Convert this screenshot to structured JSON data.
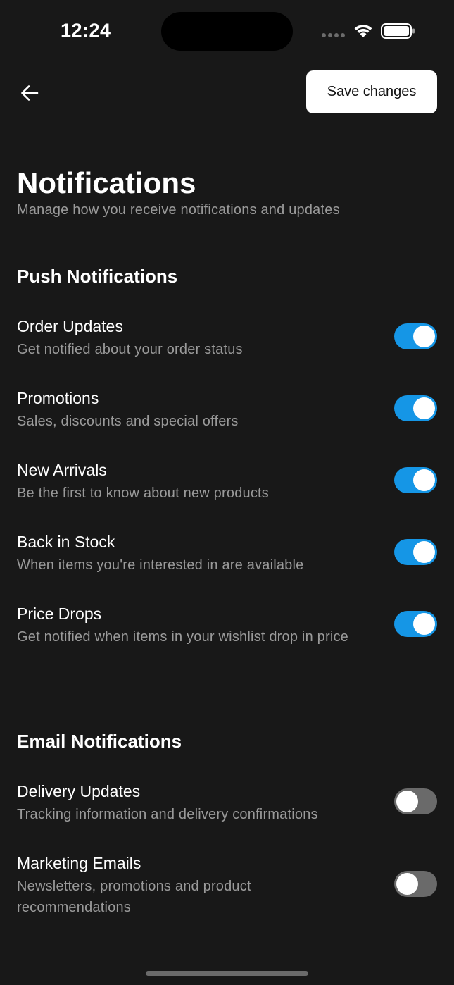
{
  "status_bar": {
    "time": "12:24"
  },
  "header": {
    "save_label": "Save changes"
  },
  "page": {
    "title": "Notifications",
    "subtitle": "Manage how you receive notifications and updates"
  },
  "push": {
    "title": "Push Notifications",
    "items": [
      {
        "label": "Order Updates",
        "description": "Get notified about your order status",
        "enabled": true
      },
      {
        "label": "Promotions",
        "description": "Sales, discounts and special offers",
        "enabled": true
      },
      {
        "label": "New Arrivals",
        "description": "Be the first to know about new products",
        "enabled": true
      },
      {
        "label": "Back in Stock",
        "description": "When items you're interested in are available",
        "enabled": true
      },
      {
        "label": "Price Drops",
        "description": "Get notified when items in your wishlist drop in price",
        "enabled": true
      }
    ]
  },
  "email": {
    "title": "Email Notifications",
    "items": [
      {
        "label": "Delivery Updates",
        "description": "Tracking information and delivery confirmations",
        "enabled": false
      },
      {
        "label": "Marketing Emails",
        "description": "Newsletters, promotions and product recommendations",
        "enabled": false
      }
    ]
  },
  "colors": {
    "background": "#181818",
    "toggle_on": "#1596e6",
    "toggle_off": "#6a6a6a",
    "secondary_text": "#9a9a9a"
  },
  "icons": {
    "back": "arrow-left-icon",
    "wifi": "wifi-icon",
    "battery": "battery-icon",
    "signal": "signal-icon"
  }
}
